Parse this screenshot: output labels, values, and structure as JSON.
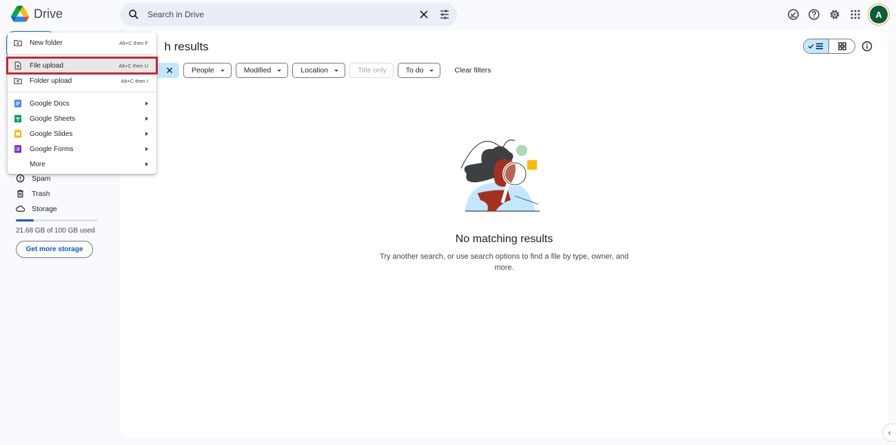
{
  "app": {
    "name": "Drive"
  },
  "search": {
    "placeholder": "Search in Drive",
    "value": ""
  },
  "header_icons": [
    "ready-for-offline-icon",
    "help-icon",
    "settings-icon",
    "apps-grid-icon"
  ],
  "account": {
    "avatar_letter": "A",
    "avatar_color": "#0b5d3b"
  },
  "main": {
    "title": "Search results",
    "title_visible": "h results",
    "filters": [
      {
        "label": "People",
        "disabled": false
      },
      {
        "label": "Modified",
        "disabled": false
      },
      {
        "label": "Location",
        "disabled": false
      },
      {
        "label": "Title only",
        "disabled": true
      },
      {
        "label": "To do",
        "disabled": false
      }
    ],
    "clear_filters": "Clear filters",
    "view": {
      "selected": "list",
      "options": [
        "list",
        "grid"
      ]
    },
    "empty_state": {
      "title": "No matching results",
      "description": "Try another search, or use search options to find a file by type, owner, and more."
    }
  },
  "new_menu": {
    "items": [
      {
        "label": "New folder",
        "shortcut": "Alt+C then F",
        "icon": "new-folder-icon"
      },
      {
        "label": "File upload",
        "shortcut": "Alt+C then U",
        "icon": "file-upload-icon",
        "highlighted": true
      },
      {
        "label": "Folder upload",
        "shortcut": "Alt+C then I",
        "icon": "folder-upload-icon"
      },
      {
        "label": "Google Docs",
        "submenu": true,
        "icon": "google-docs-icon",
        "color": "#4285f4"
      },
      {
        "label": "Google Sheets",
        "submenu": true,
        "icon": "google-sheets-icon",
        "color": "#0f9d58"
      },
      {
        "label": "Google Slides",
        "submenu": true,
        "icon": "google-slides-icon",
        "color": "#f4b400"
      },
      {
        "label": "Google Forms",
        "submenu": true,
        "icon": "google-forms-icon",
        "color": "#7627bb"
      },
      {
        "label": "More",
        "submenu": true
      }
    ]
  },
  "sidebar": {
    "items": [
      {
        "label": "Spam",
        "icon": "spam-icon"
      },
      {
        "label": "Trash",
        "icon": "trash-icon"
      },
      {
        "label": "Storage",
        "icon": "cloud-icon"
      }
    ],
    "storage": {
      "used_text": "21.68 GB of 100 GB used",
      "used_fraction": 0.2168,
      "button": "Get more storage"
    }
  }
}
